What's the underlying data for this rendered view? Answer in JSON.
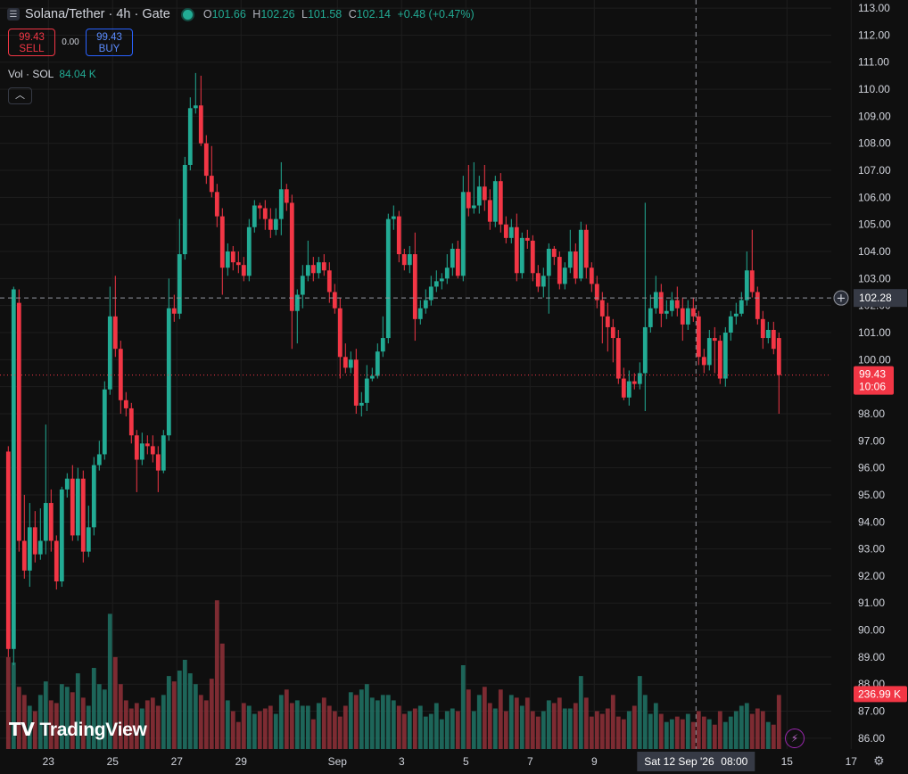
{
  "header": {
    "symbol_title": "Solana/Tether · 4h · Gate",
    "ohlc": [
      {
        "key": "O",
        "value": "101.66"
      },
      {
        "key": "H",
        "value": "102.26"
      },
      {
        "key": "L",
        "value": "101.58"
      },
      {
        "key": "C",
        "value": "102.14"
      }
    ],
    "change": "+0.48 (+0.47%)"
  },
  "trade": {
    "sell_price": "99.43",
    "sell_label": "SELL",
    "spread": "0.00",
    "buy_price": "99.43",
    "buy_label": "BUY"
  },
  "volume_legend": {
    "label": "Vol · SOL",
    "value": "84.04 K"
  },
  "watermark": "TradingView",
  "colors": {
    "up": "#22ab94",
    "down": "#f23645",
    "background": "#0f0f0f",
    "grid": "#1e1e1e",
    "text": "#d1d4dc",
    "crosshair": "#9598a1"
  },
  "crosshair": {
    "price": "102.28",
    "date": "Sat 12 Sep '26",
    "time": "08:00"
  },
  "last_price": {
    "price": "99.43",
    "countdown": "10:06"
  },
  "volume_label": "236.99 K",
  "chart_data": {
    "type": "candlestick",
    "title": "Solana/Tether · 4h · Gate",
    "ylim": [
      85.6,
      113.3
    ],
    "y_ticks": [
      "113.00",
      "112.00",
      "111.00",
      "110.00",
      "109.00",
      "108.00",
      "107.00",
      "106.00",
      "105.00",
      "104.00",
      "103.00",
      "102.00",
      "101.00",
      "100.00",
      "99.00",
      "98.00",
      "97.00",
      "96.00",
      "95.00",
      "94.00",
      "93.00",
      "92.00",
      "91.00",
      "90.00",
      "89.00",
      "88.00",
      "87.00",
      "86.00"
    ],
    "x_ticks": [
      {
        "label": "23",
        "pos": 7.5
      },
      {
        "label": "25",
        "pos": 19.5
      },
      {
        "label": "27",
        "pos": 31.5
      },
      {
        "label": "29",
        "pos": 43.5
      },
      {
        "label": "Sep",
        "pos": 61.5
      },
      {
        "label": "3",
        "pos": 73.5
      },
      {
        "label": "5",
        "pos": 85.5
      },
      {
        "label": "7",
        "pos": 97.5
      },
      {
        "label": "9",
        "pos": 109.5
      },
      {
        "label": "15",
        "pos": 145.5
      },
      {
        "label": "17",
        "pos": 157.5
      }
    ],
    "candles": [
      [
        96.6,
        89.3,
        96.8,
        89.0
      ],
      [
        89.3,
        102.6,
        102.7,
        88.7
      ],
      [
        102.1,
        93.3,
        102.6,
        92.9
      ],
      [
        93.3,
        92.2,
        95.0,
        91.9
      ],
      [
        92.2,
        93.8,
        94.7,
        91.6
      ],
      [
        93.8,
        92.8,
        94.4,
        92.5
      ],
      [
        92.8,
        93.3,
        94.5,
        92.6
      ],
      [
        93.3,
        94.7,
        97.6,
        92.8
      ],
      [
        94.7,
        93.3,
        95.2,
        92.9
      ],
      [
        93.3,
        91.8,
        93.5,
        91.5
      ],
      [
        91.8,
        95.2,
        95.3,
        91.6
      ],
      [
        95.2,
        95.6,
        95.8,
        94.9
      ],
      [
        95.6,
        93.5,
        96.1,
        93.3
      ],
      [
        93.5,
        95.6,
        96.0,
        93.3
      ],
      [
        95.6,
        92.9,
        95.9,
        92.5
      ],
      [
        92.9,
        93.8,
        94.6,
        92.7
      ],
      [
        93.8,
        96.1,
        96.4,
        93.5
      ],
      [
        96.1,
        96.5,
        97.0,
        95.9
      ],
      [
        96.5,
        98.9,
        99.2,
        96.3
      ],
      [
        98.9,
        101.6,
        102.7,
        98.7
      ],
      [
        101.6,
        100.4,
        103.1,
        100.1
      ],
      [
        100.4,
        98.5,
        100.7,
        98.0
      ],
      [
        98.5,
        98.2,
        98.8,
        97.9
      ],
      [
        98.2,
        97.2,
        98.4,
        96.9
      ],
      [
        97.2,
        96.3,
        97.4,
        95.1
      ],
      [
        96.3,
        96.9,
        97.3,
        96.1
      ],
      [
        96.9,
        96.8,
        97.2,
        96.5
      ],
      [
        96.8,
        96.5,
        97.2,
        96.2
      ],
      [
        96.5,
        95.9,
        96.8,
        95.1
      ],
      [
        95.9,
        97.2,
        97.4,
        95.8
      ],
      [
        97.2,
        101.9,
        103.0,
        97.0
      ],
      [
        101.9,
        101.7,
        102.4,
        101.4
      ],
      [
        101.7,
        103.9,
        105.2,
        101.5
      ],
      [
        103.9,
        107.2,
        107.5,
        103.7
      ],
      [
        107.2,
        109.3,
        109.7,
        107.0
      ],
      [
        109.3,
        109.4,
        110.6,
        109.1
      ],
      [
        109.4,
        108.0,
        110.5,
        107.9
      ],
      [
        108.0,
        106.8,
        108.3,
        106.5
      ],
      [
        106.8,
        106.2,
        107.9,
        106.0
      ],
      [
        106.2,
        105.3,
        106.5,
        104.9
      ],
      [
        105.3,
        103.4,
        105.6,
        102.4
      ],
      [
        103.4,
        104.0,
        104.3,
        103.1
      ],
      [
        104.0,
        103.6,
        104.2,
        103.3
      ],
      [
        103.6,
        103.5,
        104.0,
        103.2
      ],
      [
        103.5,
        103.1,
        103.8,
        102.9
      ],
      [
        103.1,
        104.9,
        105.2,
        102.9
      ],
      [
        104.9,
        105.7,
        105.9,
        104.7
      ],
      [
        105.7,
        105.6,
        105.8,
        105.2
      ],
      [
        105.6,
        105.2,
        105.9,
        104.8
      ],
      [
        105.2,
        104.8,
        105.6,
        104.5
      ],
      [
        104.8,
        105.2,
        105.6,
        104.6
      ],
      [
        105.2,
        106.3,
        107.3,
        104.6
      ],
      [
        106.3,
        105.8,
        106.5,
        105.5
      ],
      [
        105.8,
        101.8,
        106.1,
        100.4
      ],
      [
        101.8,
        102.4,
        102.6,
        100.6
      ],
      [
        102.4,
        103.1,
        103.5,
        101.9
      ],
      [
        103.1,
        103.5,
        104.4,
        102.9
      ],
      [
        103.5,
        103.2,
        103.8,
        102.9
      ],
      [
        103.2,
        103.6,
        103.8,
        103.0
      ],
      [
        103.6,
        103.3,
        103.9,
        103.1
      ],
      [
        103.3,
        102.5,
        103.6,
        102.1
      ],
      [
        102.5,
        101.9,
        102.8,
        101.7
      ],
      [
        101.9,
        100.1,
        102.3,
        99.3
      ],
      [
        100.1,
        99.7,
        100.6,
        99.5
      ],
      [
        99.7,
        100.0,
        100.3,
        99.5
      ],
      [
        100.0,
        98.3,
        100.4,
        98.0
      ],
      [
        98.3,
        98.4,
        98.8,
        97.9
      ],
      [
        98.4,
        99.3,
        99.8,
        98.1
      ],
      [
        99.3,
        99.4,
        99.7,
        99.2
      ],
      [
        99.4,
        100.3,
        100.6,
        99.3
      ],
      [
        100.3,
        100.8,
        101.6,
        100.1
      ],
      [
        100.8,
        105.2,
        105.4,
        100.6
      ],
      [
        105.2,
        105.3,
        105.7,
        104.8
      ],
      [
        105.3,
        103.9,
        105.5,
        103.6
      ],
      [
        103.9,
        103.5,
        104.1,
        103.3
      ],
      [
        103.5,
        103.9,
        104.2,
        103.2
      ],
      [
        103.9,
        101.5,
        104.7,
        100.7
      ],
      [
        101.5,
        101.9,
        102.2,
        101.3
      ],
      [
        101.9,
        102.2,
        102.6,
        101.7
      ],
      [
        102.2,
        102.7,
        103.1,
        102.0
      ],
      [
        102.7,
        102.9,
        103.3,
        102.5
      ],
      [
        102.9,
        103.0,
        103.2,
        102.6
      ],
      [
        103.0,
        103.4,
        103.9,
        102.8
      ],
      [
        103.4,
        104.1,
        104.3,
        103.1
      ],
      [
        104.1,
        103.1,
        104.4,
        103.0
      ],
      [
        103.1,
        106.2,
        106.8,
        102.9
      ],
      [
        106.2,
        105.6,
        107.2,
        105.3
      ],
      [
        105.6,
        105.7,
        107.3,
        105.4
      ],
      [
        105.7,
        106.4,
        106.8,
        105.4
      ],
      [
        106.4,
        105.9,
        107.2,
        105.5
      ],
      [
        105.9,
        105.1,
        106.3,
        104.8
      ],
      [
        105.1,
        106.6,
        106.8,
        104.9
      ],
      [
        106.6,
        105.0,
        106.9,
        104.7
      ],
      [
        105.0,
        104.5,
        105.3,
        104.3
      ],
      [
        104.5,
        104.9,
        105.2,
        104.3
      ],
      [
        104.9,
        103.2,
        105.4,
        102.9
      ],
      [
        103.2,
        104.5,
        104.7,
        103.0
      ],
      [
        104.5,
        104.4,
        104.8,
        104.1
      ],
      [
        104.4,
        103.2,
        104.6,
        102.9
      ],
      [
        103.2,
        102.7,
        103.5,
        102.5
      ],
      [
        102.7,
        103.1,
        103.4,
        102.3
      ],
      [
        103.1,
        104.1,
        104.3,
        101.7
      ],
      [
        104.1,
        103.8,
        104.2,
        103.5
      ],
      [
        103.8,
        102.8,
        104.0,
        102.6
      ],
      [
        102.8,
        103.4,
        103.6,
        102.6
      ],
      [
        103.4,
        104.0,
        104.8,
        103.2
      ],
      [
        104.0,
        103.0,
        104.3,
        102.8
      ],
      [
        103.0,
        104.8,
        105.1,
        102.9
      ],
      [
        104.8,
        103.4,
        105.0,
        103.0
      ],
      [
        103.4,
        102.8,
        103.6,
        102.5
      ],
      [
        102.8,
        102.2,
        103.1,
        101.9
      ],
      [
        102.2,
        101.6,
        102.5,
        100.6
      ],
      [
        101.6,
        101.2,
        102.1,
        100.3
      ],
      [
        101.2,
        100.8,
        101.5,
        99.9
      ],
      [
        100.8,
        99.3,
        101.1,
        99.1
      ],
      [
        99.3,
        98.6,
        99.7,
        98.5
      ],
      [
        98.6,
        99.2,
        99.6,
        98.3
      ],
      [
        99.2,
        99.1,
        99.5,
        98.9
      ],
      [
        99.1,
        99.5,
        99.9,
        98.9
      ],
      [
        99.5,
        101.2,
        105.8,
        98.1
      ],
      [
        101.2,
        101.9,
        102.4,
        101.0
      ],
      [
        101.9,
        102.5,
        103.1,
        101.7
      ],
      [
        102.5,
        101.7,
        102.8,
        101.2
      ],
      [
        101.7,
        101.8,
        102.2,
        101.5
      ],
      [
        101.8,
        102.2,
        102.5,
        101.6
      ],
      [
        102.2,
        101.9,
        102.7,
        101.6
      ],
      [
        101.9,
        101.3,
        102.3,
        100.7
      ],
      [
        101.3,
        101.9,
        102.2,
        101.1
      ],
      [
        101.9,
        101.6,
        102.3,
        101.4
      ],
      [
        101.6,
        100.1,
        101.8,
        99.8
      ],
      [
        100.1,
        99.8,
        100.4,
        99.5
      ],
      [
        99.8,
        100.8,
        101.1,
        99.6
      ],
      [
        100.8,
        100.7,
        101.2,
        99.5
      ],
      [
        100.7,
        99.3,
        100.9,
        99.1
      ],
      [
        99.3,
        101.0,
        101.2,
        99.0
      ],
      [
        101.0,
        101.6,
        101.8,
        100.7
      ],
      [
        101.6,
        101.7,
        102.1,
        101.3
      ],
      [
        101.7,
        102.2,
        102.5,
        101.6
      ],
      [
        102.2,
        103.3,
        104.0,
        102.0
      ],
      [
        103.3,
        102.5,
        104.8,
        102.3
      ],
      [
        102.5,
        101.5,
        102.7,
        101.3
      ],
      [
        101.5,
        100.8,
        101.8,
        100.4
      ],
      [
        100.8,
        101.1,
        101.4,
        100.6
      ],
      [
        101.1,
        100.4,
        101.4,
        100.2
      ],
      [
        100.8,
        99.43,
        101.0,
        98.0
      ]
    ],
    "volumes": [
      89.0,
      88.8,
      87.9,
      87.6,
      87.2,
      87.0,
      87.6,
      88.1,
      87.4,
      87.3,
      88.0,
      87.9,
      87.7,
      88.4,
      87.5,
      87.2,
      88.6,
      88.0,
      87.8,
      90.6,
      89.0,
      88.0,
      87.4,
      87.1,
      87.3,
      87.1,
      87.4,
      87.5,
      87.2,
      87.6,
      88.3,
      88.1,
      88.5,
      88.9,
      88.4,
      88.0,
      87.6,
      87.4,
      88.2,
      91.1,
      89.5,
      87.4,
      87.0,
      86.6,
      87.3,
      87.2,
      86.9,
      87.0,
      87.1,
      87.2,
      86.9,
      87.6,
      87.8,
      87.3,
      87.4,
      87.2,
      87.2,
      86.7,
      87.3,
      87.5,
      87.2,
      87.0,
      86.8,
      87.2,
      87.7,
      87.6,
      87.8,
      88.0,
      87.5,
      87.4,
      87.6,
      87.6,
      87.4,
      87.2,
      86.9,
      87.0,
      87.1,
      87.2,
      86.8,
      86.9,
      87.3,
      86.7,
      87.0,
      87.1,
      87.0,
      88.7,
      87.8,
      87.0,
      87.6,
      87.9,
      87.3,
      87.1,
      87.8,
      87.0,
      87.6,
      87.5,
      87.2,
      87.5,
      87.0,
      86.8,
      87.0,
      87.4,
      87.3,
      87.5,
      87.1,
      87.1,
      87.3,
      88.3,
      87.5,
      86.8,
      87.0,
      86.9,
      87.1,
      87.6,
      86.8,
      86.7,
      87.0,
      87.2,
      88.3,
      87.6,
      86.9,
      87.3,
      86.9,
      86.6,
      86.7,
      86.8,
      86.7,
      86.9,
      86.6,
      87.0,
      86.8,
      86.7,
      86.5,
      87.0,
      86.6,
      86.8,
      87.0,
      87.2,
      87.3,
      86.9,
      87.1,
      87.0,
      86.6,
      86.5,
      87.6
    ]
  }
}
